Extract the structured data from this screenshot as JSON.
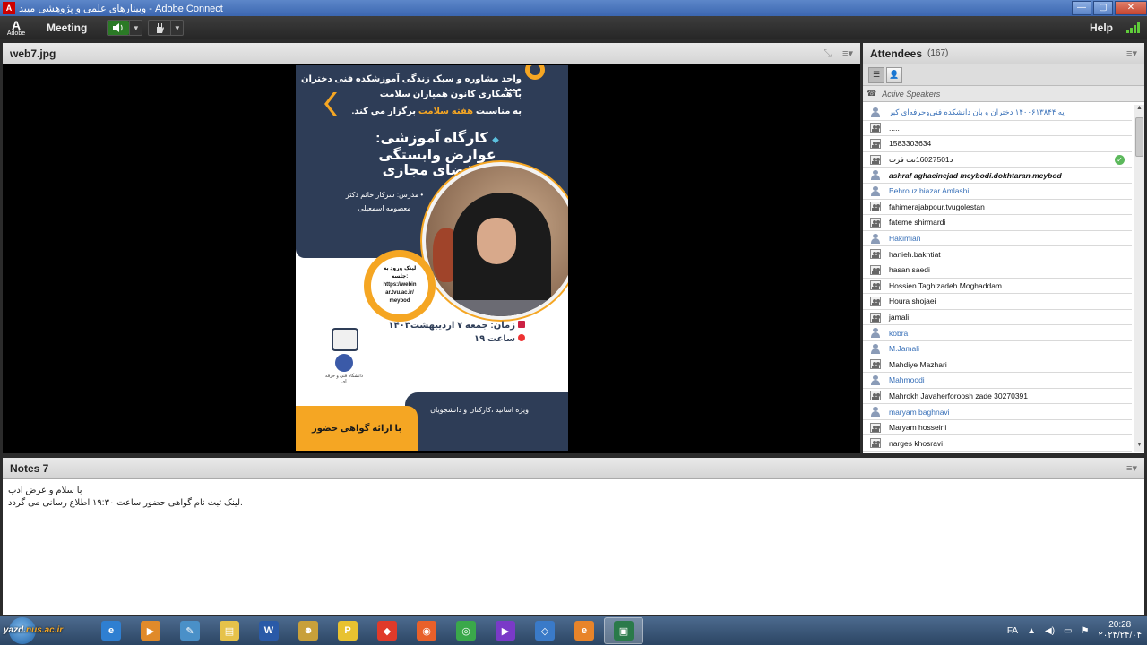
{
  "window": {
    "title": "وبینارهای علمی و پژوهشی میبد - Adobe Connect",
    "min_label": "—",
    "max_label": "▢",
    "close_label": "✕"
  },
  "menubar": {
    "adobe_label": "Adobe",
    "meeting_label": "Meeting",
    "help_label": "Help"
  },
  "share_pod": {
    "title": "web7.jpg",
    "poster": {
      "line1": "واحد مشاوره و سبک زندگی آموزشکده فنی دختران میبد",
      "line2": "با همکاری کانون همیاران سلامت",
      "line3_pre": "به مناسبت",
      "line3_hl": "هفته سلامت",
      "line3_post": "برگزار می کند.",
      "workshop_bullet": "◆",
      "workshop_title": "کارگاه آموزشی:",
      "workshop_sub1": "عوارض وابستگی",
      "workshop_sub2": "به فضای مجازی",
      "teacher_line1": "• مدرس: سرکار خانم دکتر",
      "teacher_line2": "معصومه اسمعیلی",
      "link_line1": "لینک ورود به",
      "link_line2": "جلسه:",
      "link_line3": "https://webin",
      "link_line4": "ar.tvu.ac.ir/",
      "link_line5": "meybod",
      "time_line1": "زمان: جمعه ۷ اردیبهشت۱۴۰۳",
      "time_line2": "ساعت ۱۹",
      "audience": "ویژه اساتید ،کارکنان و دانشجویان",
      "certificate": "با ارائه گواهی حضور",
      "logo_caption": "دانشگاه فنی و حرفه ای"
    }
  },
  "attendees": {
    "title": "Attendees",
    "count": "(167)",
    "active_speakers": "Active Speakers",
    "list": [
      {
        "name": "یه ۱۴۰۰۶۱۳۸۴۴ دختران و بان دانشکده فنی‌وحرفه‌ای کبر",
        "blue": true,
        "icon": "single"
      },
      {
        "name": ".....",
        "icon": "multi"
      },
      {
        "name": "1583303634",
        "icon": "multi"
      },
      {
        "name": "د16027501نت فرت",
        "icon": "multi",
        "check": "✓"
      },
      {
        "name": "ashraf aghaeinejad meybodi.dokhtaran.meybod",
        "icon": "single",
        "italic": true
      },
      {
        "name": "Behrouz biazar Amlashi",
        "blue": true,
        "icon": "single"
      },
      {
        "name": "fahimerajabpour.tvugolestan",
        "icon": "multi"
      },
      {
        "name": "fateme shirmardi",
        "icon": "multi"
      },
      {
        "name": "Hakimian",
        "blue": true,
        "icon": "single"
      },
      {
        "name": "hanieh.bakhtiat",
        "icon": "multi"
      },
      {
        "name": "hasan saedi",
        "icon": "multi"
      },
      {
        "name": "Hossien Taghizadeh Moghaddam",
        "icon": "multi"
      },
      {
        "name": "Houra shojaei",
        "icon": "multi"
      },
      {
        "name": "jamali",
        "icon": "multi"
      },
      {
        "name": "kobra",
        "blue": true,
        "icon": "single"
      },
      {
        "name": "M.Jamali",
        "blue": true,
        "icon": "single"
      },
      {
        "name": "Mahdiye Mazhari",
        "icon": "multi"
      },
      {
        "name": "Mahmoodi",
        "blue": true,
        "icon": "single"
      },
      {
        "name": "Mahrokh Javaherforoosh zade 30270391",
        "icon": "multi"
      },
      {
        "name": "maryam baghnavi",
        "blue": true,
        "icon": "single"
      },
      {
        "name": "Maryam hosseini",
        "icon": "multi"
      },
      {
        "name": "narges khosravi",
        "icon": "multi"
      }
    ]
  },
  "notes": {
    "title": "Notes 7",
    "line1": "با سلام و عرض ادب",
    "line2": "لینک ثبت نام گواهی حضور ساعت ۱۹:۳۰ اطلاع رسانی می گردد."
  },
  "taskbar": {
    "watermark_pre": "yazd.",
    "watermark_hl": "nus.ac.ir",
    "lang": "FA",
    "time": "20:28",
    "date": "۲۰۲۴/۲۴/۰۴",
    "apps": [
      {
        "name": "ie",
        "glyph": "e",
        "color": "#2f7fd1"
      },
      {
        "name": "media-player",
        "glyph": "▶",
        "color": "#e08a2a"
      },
      {
        "name": "paint",
        "glyph": "✎",
        "color": "#4a90c8"
      },
      {
        "name": "explorer",
        "glyph": "▤",
        "color": "#e6c24a"
      },
      {
        "name": "word",
        "glyph": "W",
        "color": "#2a5aa8"
      },
      {
        "name": "game",
        "glyph": "☻",
        "color": "#c8a03a"
      },
      {
        "name": "pixel",
        "glyph": "P",
        "color": "#e8c230"
      },
      {
        "name": "anydesk",
        "glyph": "◆",
        "color": "#e03a2a"
      },
      {
        "name": "firefox",
        "glyph": "◉",
        "color": "#e8602a"
      },
      {
        "name": "chrome",
        "glyph": "◎",
        "color": "#3aa84a"
      },
      {
        "name": "media",
        "glyph": "▶",
        "color": "#7a3ac8"
      },
      {
        "name": "network",
        "glyph": "◇",
        "color": "#3a7ac8"
      },
      {
        "name": "app-orange",
        "glyph": "e",
        "color": "#e8842a"
      },
      {
        "name": "adobe-connect",
        "glyph": "▣",
        "color": "#2a7a4a"
      }
    ]
  }
}
